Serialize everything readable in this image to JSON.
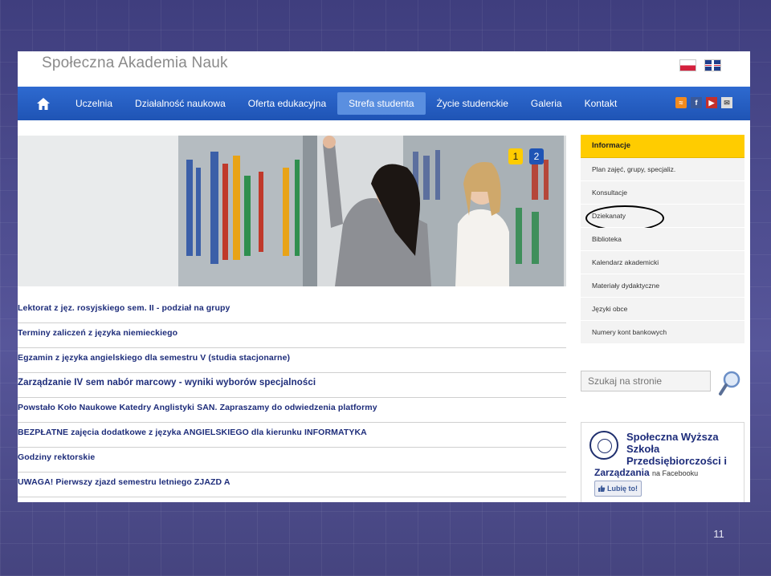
{
  "site": {
    "logo_text": "Społeczna Akademia Nauk"
  },
  "nav": {
    "items": [
      {
        "label": "Uczelnia"
      },
      {
        "label": "Działalność naukowa"
      },
      {
        "label": "Oferta edukacyjna"
      },
      {
        "label": "Strefa studenta",
        "active": true
      },
      {
        "label": "Życie studenckie"
      },
      {
        "label": "Galeria"
      },
      {
        "label": "Kontakt"
      }
    ]
  },
  "hero": {
    "dots": [
      "1",
      "2"
    ]
  },
  "news": [
    "Lektorat z jęz. rosyjskiego sem. II - podział na grupy",
    "Terminy zaliczeń z języka niemieckiego",
    "Egzamin z języka angielskiego dla semestru V (studia stacjonarne)",
    "Zarządzanie IV sem nabór marcowy - wyniki wyborów specjalności",
    "Powstało Koło Naukowe Katedry Anglistyki SAN. Zapraszamy do odwiedzenia platformy",
    "BEZPŁATNE zajęcia dodatkowe z języka ANGIELSKIEGO dla kierunku INFORMATYKA",
    "Godziny rektorskie",
    "UWAGA! Pierwszy zjazd semestru letniego ZJAZD A"
  ],
  "sidebar": {
    "heading": "Informacje",
    "items": [
      "Plan zajęć, grupy, specjaliz.",
      "Konsultacje",
      "Dziekanaty",
      "Biblioteka",
      "Kalendarz akademicki",
      "Materiały dydaktyczne",
      "Języki obce",
      "Numery kont bankowych"
    ]
  },
  "search": {
    "placeholder": "Szukaj na stronie"
  },
  "facebook": {
    "name": "Społeczna Wyższa Szkoła Przedsiębiorczości i",
    "name_line2": "Zarządzania",
    "suffix": "na Facebooku",
    "like_label": "Lubię to!"
  },
  "slide": {
    "number": "11"
  },
  "colors": {
    "nav_blue": "#1f54b5",
    "accent_yellow": "#ffcc00",
    "link_blue": "#1d2c7a"
  }
}
